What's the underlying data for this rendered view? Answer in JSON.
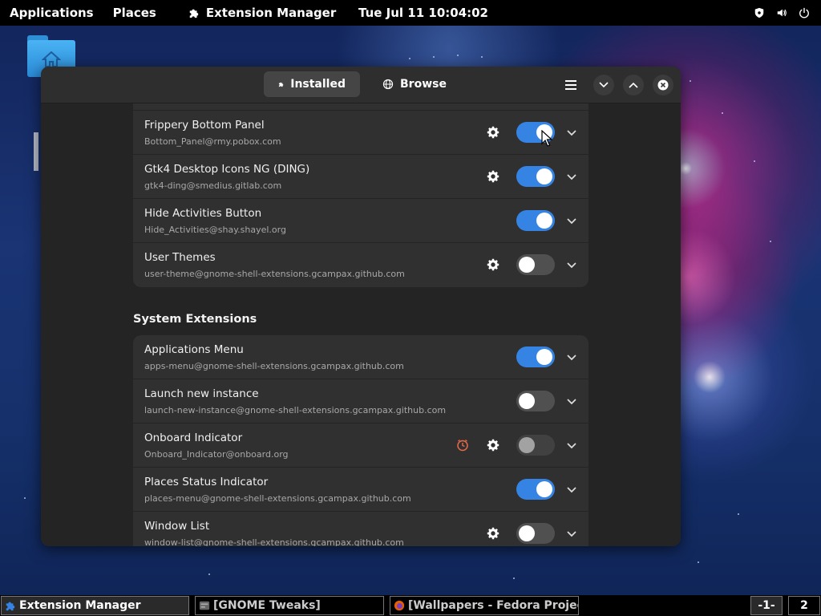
{
  "topbar": {
    "applications": "Applications",
    "places": "Places",
    "app_name": "Extension Manager",
    "clock": "Tue Jul 11  10:04:02"
  },
  "window": {
    "tabs": [
      {
        "label": "Installed",
        "icon": "puzzle-icon",
        "active": true
      },
      {
        "label": "Browse",
        "icon": "globe-icon",
        "active": false
      }
    ]
  },
  "user_extensions": [
    {
      "name": "Frippery Bottom Panel",
      "uuid": "Bottom_Panel@rmy.pobox.com",
      "settings": true,
      "enabled": true
    },
    {
      "name": "Gtk4 Desktop Icons NG (DING)",
      "uuid": "gtk4-ding@smedius.gitlab.com",
      "settings": true,
      "enabled": true
    },
    {
      "name": "Hide Activities Button",
      "uuid": "Hide_Activities@shay.shayel.org",
      "settings": false,
      "enabled": true
    },
    {
      "name": "User Themes",
      "uuid": "user-theme@gnome-shell-extensions.gcampax.github.com",
      "settings": true,
      "enabled": false
    }
  ],
  "system_section_title": "System Extensions",
  "system_extensions": [
    {
      "name": "Applications Menu",
      "uuid": "apps-menu@gnome-shell-extensions.gcampax.github.com",
      "settings": false,
      "enabled": true
    },
    {
      "name": "Launch new instance",
      "uuid": "launch-new-instance@gnome-shell-extensions.gcampax.github.com",
      "settings": false,
      "enabled": false
    },
    {
      "name": "Onboard Indicator",
      "uuid": "Onboard_Indicator@onboard.org",
      "settings": true,
      "enabled": false,
      "warning": true
    },
    {
      "name": "Places Status Indicator",
      "uuid": "places-menu@gnome-shell-extensions.gcampax.github.com",
      "settings": false,
      "enabled": true
    },
    {
      "name": "Window List",
      "uuid": "window-list@gnome-shell-extensions.gcampax.github.com",
      "settings": true,
      "enabled": false
    }
  ],
  "taskbar": {
    "tasks": [
      {
        "label": "Extension Manager",
        "active": true
      },
      {
        "label": "[GNOME Tweaks]",
        "active": false
      },
      {
        "label": "[Wallpapers - Fedora Project ...",
        "active": false
      }
    ],
    "workspaces": [
      "-1-",
      "2"
    ]
  },
  "colors": {
    "accent": "#3584e4",
    "window_bg": "#242424",
    "row_bg": "#303030",
    "warning": "#e66a4a"
  }
}
